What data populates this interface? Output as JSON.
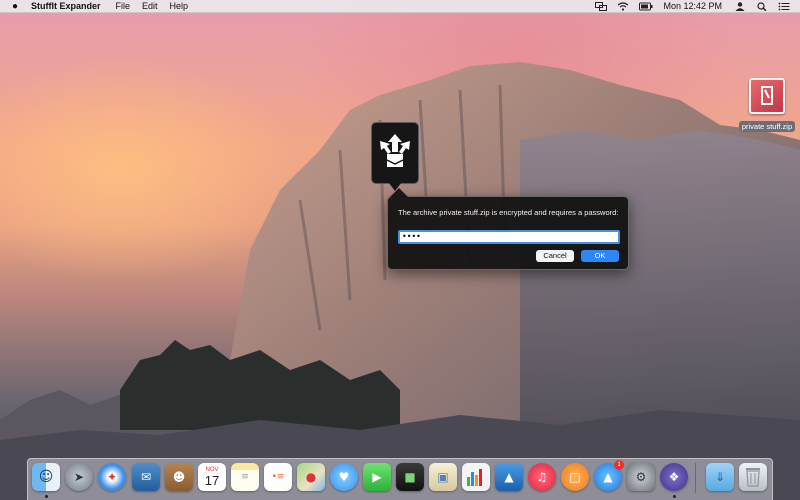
{
  "menubar": {
    "apple_icon": "apple-logo-icon",
    "app_name": "StuffIt Expander",
    "menus": [
      "File",
      "Edit",
      "Help"
    ],
    "status_icons": [
      "display-mirroring-icon",
      "wifi-icon",
      "battery-icon",
      "user-icon",
      "spotlight-icon",
      "notification-center-icon"
    ],
    "clock": "Mon 12:42 PM"
  },
  "desktop": {
    "file_label": "private stuff.zip"
  },
  "dialog": {
    "message": "The archive private stuff.zip is encrypted and requires a password:",
    "password_value": "••••",
    "cancel_label": "Cancel",
    "ok_label": "OK"
  },
  "dock": {
    "calendar_month": "NOV",
    "calendar_day": "17",
    "app_store_badge": "1",
    "items": [
      "finder-icon",
      "launchpad-icon",
      "safari-icon",
      "mail-icon",
      "contacts-icon",
      "calendar-icon",
      "notes-icon",
      "reminders-icon",
      "maps-icon",
      "messages-icon",
      "facetime-icon",
      "photo-booth-icon",
      "iphoto-icon",
      "numbers-icon",
      "keynote-icon",
      "itunes-icon",
      "ibooks-icon",
      "app-store-icon",
      "system-preferences-icon",
      "stuffit-expander-icon",
      "downloads-folder-icon",
      "trash-icon"
    ]
  },
  "colors": {
    "accent": "#2f86f6",
    "dialog_bg": "#121212",
    "menubar_bg": "#ece8ec"
  }
}
